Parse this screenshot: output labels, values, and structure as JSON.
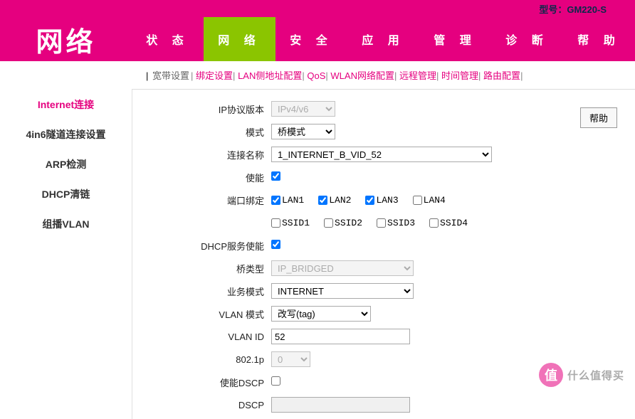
{
  "model": {
    "label": "型号：",
    "value": "GM220-S"
  },
  "logo": "网络",
  "nav": [
    "状 态",
    "网 络",
    "安 全",
    "应 用",
    "管 理",
    "诊 断",
    "帮 助"
  ],
  "nav_active_index": 1,
  "subnav": [
    "宽带设置",
    "绑定设置",
    "LAN侧地址配置",
    "QoS",
    "WLAN网络配置",
    "远程管理",
    "时间管理",
    "路由配置"
  ],
  "sidebar": [
    {
      "label": "Internet连接",
      "active": true
    },
    {
      "label": "4in6隧道连接设置",
      "active": false
    },
    {
      "label": "ARP检测",
      "active": false
    },
    {
      "label": "DHCP清链",
      "active": false
    },
    {
      "label": "组播VLAN",
      "active": false
    }
  ],
  "help_button": "帮助",
  "form": {
    "ip_version": {
      "label": "IP协议版本",
      "value": "IPv4/v6"
    },
    "mode": {
      "label": "模式",
      "value": "桥模式"
    },
    "conn_name": {
      "label": "连接名称",
      "value": "1_INTERNET_B_VID_52"
    },
    "enable": {
      "label": "使能",
      "checked": true
    },
    "port_bind": {
      "label": "端口绑定",
      "row1": [
        {
          "label": "LAN1",
          "checked": true
        },
        {
          "label": "LAN2",
          "checked": true
        },
        {
          "label": "LAN3",
          "checked": true
        },
        {
          "label": "LAN4",
          "checked": false
        }
      ],
      "row2": [
        {
          "label": "SSID1",
          "checked": false
        },
        {
          "label": "SSID2",
          "checked": false
        },
        {
          "label": "SSID3",
          "checked": false
        },
        {
          "label": "SSID4",
          "checked": false
        }
      ]
    },
    "dhcp_enable": {
      "label": "DHCP服务使能",
      "checked": true
    },
    "bridge_type": {
      "label": "桥类型",
      "value": "IP_BRIDGED"
    },
    "service_mode": {
      "label": "业务模式",
      "value": "INTERNET"
    },
    "vlan_mode": {
      "label": "VLAN 模式",
      "value": "改写(tag)"
    },
    "vlan_id": {
      "label": "VLAN ID",
      "value": "52"
    },
    "p8021": {
      "label": "802.1p",
      "value": "0"
    },
    "enable_dscp": {
      "label": "使能DSCP",
      "checked": false
    },
    "dscp": {
      "label": "DSCP",
      "value": ""
    }
  },
  "watermark": {
    "icon": "值",
    "text": "什么值得买"
  }
}
